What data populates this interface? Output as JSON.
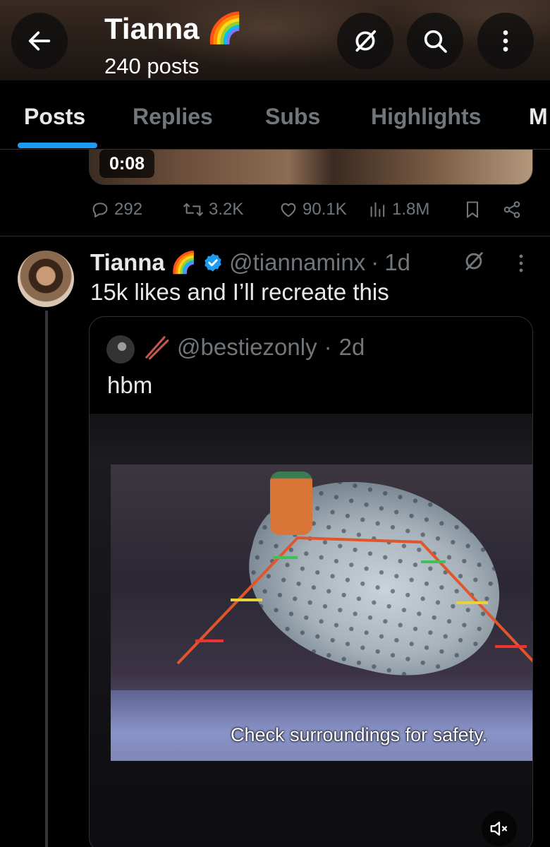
{
  "header": {
    "name": "Tianna",
    "name_emoji": "🌈",
    "post_count": "240 posts"
  },
  "tabs": [
    {
      "label": "Posts",
      "active": true
    },
    {
      "label": "Replies",
      "active": false
    },
    {
      "label": "Subs",
      "active": false
    },
    {
      "label": "Highlights",
      "active": false
    },
    {
      "label": "M",
      "active": false
    }
  ],
  "prev_post": {
    "video_duration": "0:08",
    "stats": {
      "replies": "292",
      "reposts": "3.2K",
      "likes": "90.1K",
      "views": "1.8M"
    }
  },
  "post": {
    "author_name": "Tianna",
    "author_emoji": "🌈",
    "verified": true,
    "handle": "@tiannaminx",
    "separator": "·",
    "time": "1d",
    "text": "15k likes and I’ll recreate this",
    "quote": {
      "handle": "@bestiezonly",
      "separator": "·",
      "time": "2d",
      "text": "hbm",
      "video_caption": "Check surroundings for safety."
    }
  },
  "colors": {
    "accent": "#1d9bf0",
    "muted_text": "#71767b",
    "divider": "#2f3336"
  },
  "icons": [
    "back-arrow-icon",
    "grok-icon",
    "search-icon",
    "more-vertical-icon",
    "reply-icon",
    "repost-icon",
    "like-icon",
    "views-icon",
    "bookmark-icon",
    "share-icon",
    "verified-badge-icon",
    "mute-icon"
  ]
}
